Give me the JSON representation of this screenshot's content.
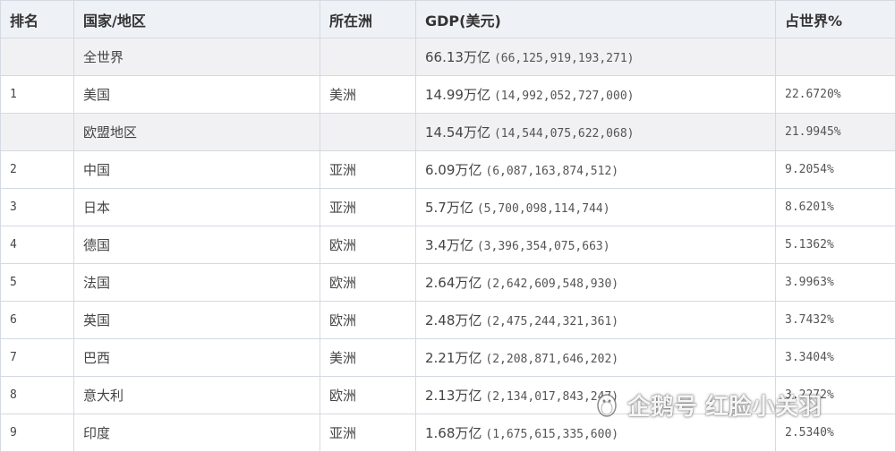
{
  "headers": {
    "rank": "排名",
    "country": "国家/地区",
    "continent": "所在洲",
    "gdp": "GDP(美元)",
    "share": "占世界%"
  },
  "rows": [
    {
      "rank": "",
      "country": "全世界",
      "continent": "",
      "gdp_short": "66.13万亿",
      "gdp_full": "(66,125,919,193,271)",
      "share": ""
    },
    {
      "rank": "1",
      "country": "美国",
      "continent": "美洲",
      "gdp_short": "14.99万亿",
      "gdp_full": "(14,992,052,727,000)",
      "share": "22.6720%"
    },
    {
      "rank": "",
      "country": "欧盟地区",
      "continent": "",
      "gdp_short": "14.54万亿",
      "gdp_full": "(14,544,075,622,068)",
      "share": "21.9945%"
    },
    {
      "rank": "2",
      "country": "中国",
      "continent": "亚洲",
      "gdp_short": "6.09万亿",
      "gdp_full": "(6,087,163,874,512)",
      "share": "9.2054%"
    },
    {
      "rank": "3",
      "country": "日本",
      "continent": "亚洲",
      "gdp_short": "5.7万亿",
      "gdp_full": "(5,700,098,114,744)",
      "share": "8.6201%"
    },
    {
      "rank": "4",
      "country": "德国",
      "continent": "欧洲",
      "gdp_short": "3.4万亿",
      "gdp_full": "(3,396,354,075,663)",
      "share": "5.1362%"
    },
    {
      "rank": "5",
      "country": "法国",
      "continent": "欧洲",
      "gdp_short": "2.64万亿",
      "gdp_full": "(2,642,609,548,930)",
      "share": "3.9963%"
    },
    {
      "rank": "6",
      "country": "英国",
      "continent": "欧洲",
      "gdp_short": "2.48万亿",
      "gdp_full": "(2,475,244,321,361)",
      "share": "3.7432%"
    },
    {
      "rank": "7",
      "country": "巴西",
      "continent": "美洲",
      "gdp_short": "2.21万亿",
      "gdp_full": "(2,208,871,646,202)",
      "share": "3.3404%"
    },
    {
      "rank": "8",
      "country": "意大利",
      "continent": "欧洲",
      "gdp_short": "2.13万亿",
      "gdp_full": "(2,134,017,843,247)",
      "share": "3.2272%"
    },
    {
      "rank": "9",
      "country": "印度",
      "continent": "亚洲",
      "gdp_short": "1.68万亿",
      "gdp_full": "(1,675,615,335,600)",
      "share": "2.5340%"
    }
  ],
  "watermark": {
    "text": "企鹅号 红脸小关羽"
  }
}
